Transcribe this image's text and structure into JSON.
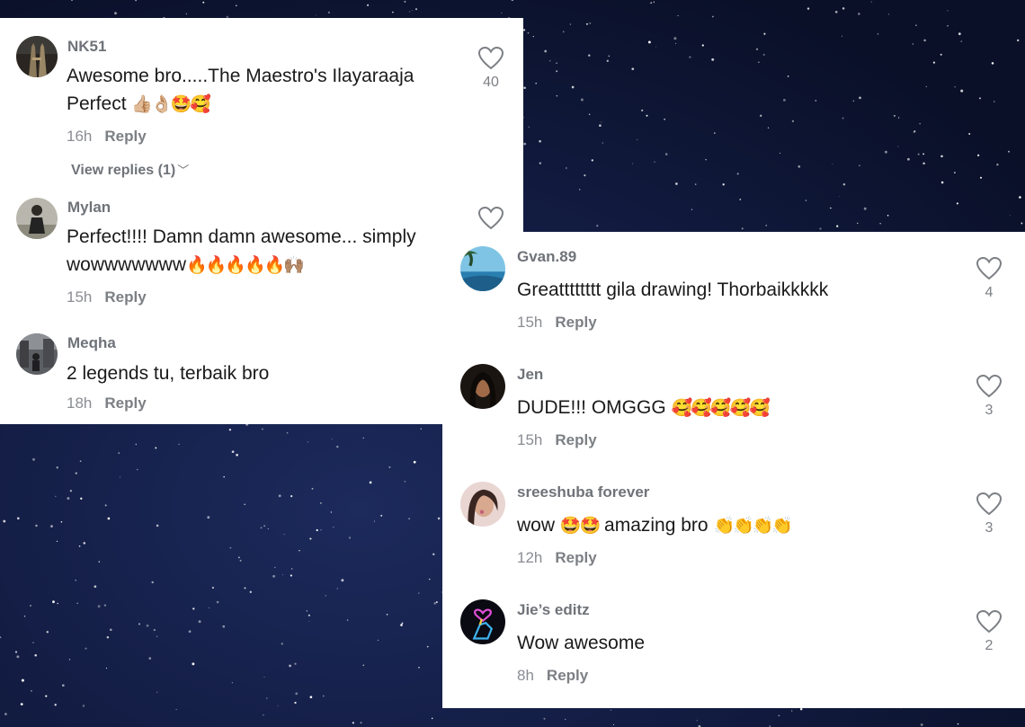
{
  "colors": {
    "background": "#0d1330",
    "panel": "#ffffff",
    "username": "#6f7379",
    "comment_text": "#1a1a1a",
    "meta": "#8a8d92"
  },
  "left_panel": {
    "comments": [
      {
        "username": "NK51",
        "text_line1": "Awesome bro.....The Maestro's Ilayaraaja",
        "text_line2": "Perfect",
        "emojis": "👍🏼👌🏼🤩🥰",
        "time": "16h",
        "reply_label": "Reply",
        "likes": "40",
        "view_replies": "View replies (1)",
        "avatar_icon": "tower-photo-icon"
      },
      {
        "username": "Mylan",
        "text_line1": "Perfect!!!! Damn damn awesome... simply",
        "text_line2": "wowwwwwww",
        "emojis": "🔥🔥🔥🔥🔥🙌🏽",
        "time": "15h",
        "reply_label": "Reply",
        "likes": "",
        "avatar_icon": "person-photo-icon"
      },
      {
        "username": "Meqha",
        "text_line1": "2 legends tu, terbaik bro",
        "time": "18h",
        "reply_label": "Reply",
        "avatar_icon": "street-photo-icon"
      }
    ]
  },
  "right_panel": {
    "comments": [
      {
        "username": "Gvan.89",
        "text": "Greatttttttt gila drawing! Thorbaikkkkk",
        "emojis": "",
        "time": "15h",
        "reply_label": "Reply",
        "likes": "4",
        "avatar_icon": "beach-photo-icon"
      },
      {
        "username": "Jen",
        "text": "DUDE!!! OMGGG",
        "emojis": "🥰🥰🥰🥰🥰",
        "time": "15h",
        "reply_label": "Reply",
        "likes": "3",
        "avatar_icon": "woman-photo-icon"
      },
      {
        "username": "sreeshuba forever",
        "text": "wow",
        "emojis_mid": "🤩🤩",
        "text_after": "amazing bro",
        "emojis": "👏👏👏👏",
        "time": "12h",
        "reply_label": "Reply",
        "likes": "3",
        "avatar_icon": "selfie-photo-icon"
      },
      {
        "username": "Jie’s editz",
        "text": "Wow awesome",
        "emojis": "",
        "time": "8h",
        "reply_label": "Reply",
        "likes": "2",
        "avatar_icon": "neon-heart-hand-icon"
      }
    ]
  }
}
